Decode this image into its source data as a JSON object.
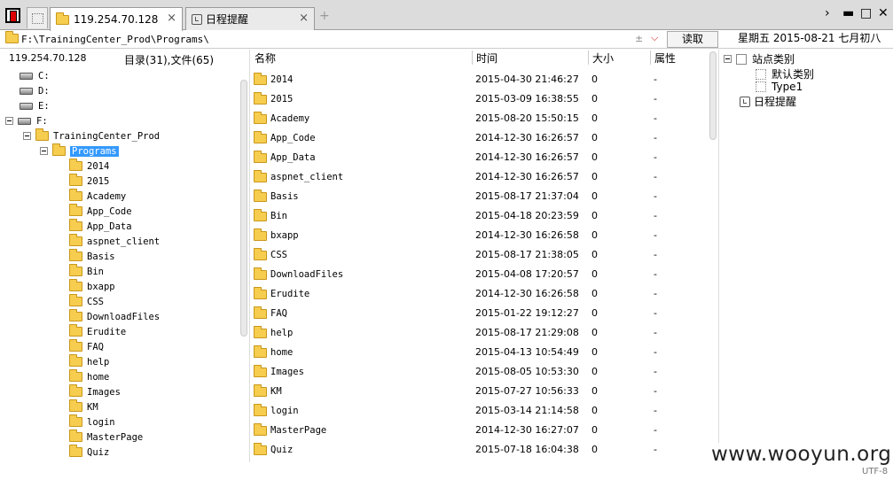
{
  "tabs": [
    {
      "label": "119.254.70.128",
      "active": true,
      "icon": "folder-icon",
      "close": "×"
    },
    {
      "label": "日程提醒",
      "active": false,
      "icon": "clock-icon",
      "close": "×"
    }
  ],
  "new_tab": "+",
  "window_controls": {
    "more": "›",
    "minimize": "▬",
    "maximize": "□",
    "close": "✕"
  },
  "address": {
    "path": "F:\\TrainingCenter_Prod\\Programs\\",
    "spinner": "±",
    "dropdown": "⌵",
    "read_label": "读取"
  },
  "date_info": "星期五  2015-08-21  七月初八",
  "host": "119.254.70.128",
  "counts": "目录(31),文件(65)",
  "tree": {
    "drives": [
      {
        "label": "C:",
        "expanded": false
      },
      {
        "label": "D:",
        "expanded": false
      },
      {
        "label": "E:",
        "expanded": false
      },
      {
        "label": "F:",
        "expanded": true
      }
    ],
    "parent": "TrainingCenter_Prod",
    "selected": "Programs",
    "children": [
      "2014",
      "2015",
      "Academy",
      "App_Code",
      "App_Data",
      "aspnet_client",
      "Basis",
      "Bin",
      "bxapp",
      "CSS",
      "DownloadFiles",
      "Erudite",
      "FAQ",
      "help",
      "home",
      "Images",
      "KM",
      "login",
      "MasterPage",
      "Quiz"
    ]
  },
  "list_headers": {
    "name": "名称",
    "time": "时间",
    "size": "大小",
    "attr": "属性"
  },
  "files": [
    {
      "name": "2014",
      "time": "2015-04-30 21:46:27",
      "size": "0",
      "attr": "-"
    },
    {
      "name": "2015",
      "time": "2015-03-09 16:38:55",
      "size": "0",
      "attr": "-"
    },
    {
      "name": "Academy",
      "time": "2015-08-20 15:50:15",
      "size": "0",
      "attr": "-"
    },
    {
      "name": "App_Code",
      "time": "2014-12-30 16:26:57",
      "size": "0",
      "attr": "-"
    },
    {
      "name": "App_Data",
      "time": "2014-12-30 16:26:57",
      "size": "0",
      "attr": "-"
    },
    {
      "name": "aspnet_client",
      "time": "2014-12-30 16:26:57",
      "size": "0",
      "attr": "-"
    },
    {
      "name": "Basis",
      "time": "2015-08-17 21:37:04",
      "size": "0",
      "attr": "-"
    },
    {
      "name": "Bin",
      "time": "2015-04-18 20:23:59",
      "size": "0",
      "attr": "-"
    },
    {
      "name": "bxapp",
      "time": "2014-12-30 16:26:58",
      "size": "0",
      "attr": "-"
    },
    {
      "name": "CSS",
      "time": "2015-08-17 21:38:05",
      "size": "0",
      "attr": "-"
    },
    {
      "name": "DownloadFiles",
      "time": "2015-04-08 17:20:57",
      "size": "0",
      "attr": "-"
    },
    {
      "name": "Erudite",
      "time": "2014-12-30 16:26:58",
      "size": "0",
      "attr": "-"
    },
    {
      "name": "FAQ",
      "time": "2015-01-22 19:12:27",
      "size": "0",
      "attr": "-"
    },
    {
      "name": "help",
      "time": "2015-08-17 21:29:08",
      "size": "0",
      "attr": "-"
    },
    {
      "name": "home",
      "time": "2015-04-13 10:54:49",
      "size": "0",
      "attr": "-"
    },
    {
      "name": "Images",
      "time": "2015-08-05 10:53:30",
      "size": "0",
      "attr": "-"
    },
    {
      "name": "KM",
      "time": "2015-07-27 10:56:33",
      "size": "0",
      "attr": "-"
    },
    {
      "name": "login",
      "time": "2015-03-14 21:14:58",
      "size": "0",
      "attr": "-"
    },
    {
      "name": "MasterPage",
      "time": "2014-12-30 16:27:07",
      "size": "0",
      "attr": "-"
    },
    {
      "name": "Quiz",
      "time": "2015-07-18 16:04:38",
      "size": "0",
      "attr": "-"
    }
  ],
  "right_panel": {
    "root": "站点类别",
    "categories": [
      "默认类别",
      "Type1"
    ],
    "reminder": "日程提醒"
  },
  "watermark": "www.wooyun.org",
  "encoding": "UTF-8"
}
